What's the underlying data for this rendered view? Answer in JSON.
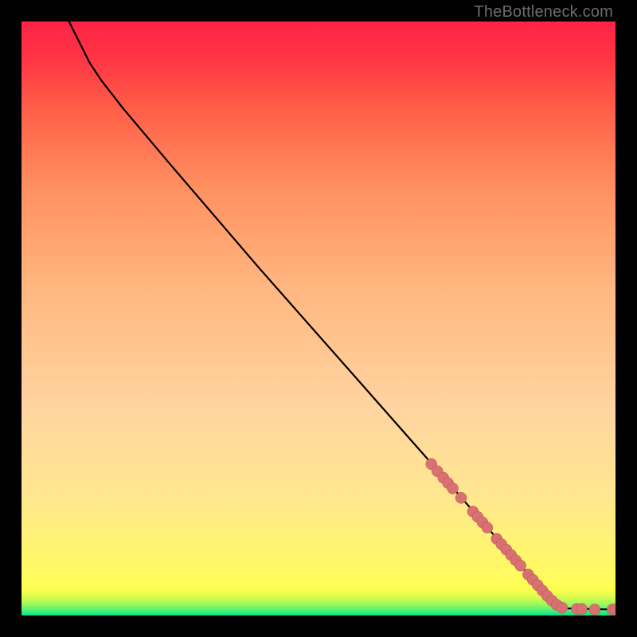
{
  "attribution": "TheBottleneck.com",
  "chart_data": {
    "type": "line",
    "title": "",
    "xlabel": "",
    "ylabel": "",
    "xlim": [
      0,
      100
    ],
    "ylim": [
      0,
      100
    ],
    "curve": [
      {
        "x": 8.0,
        "y": 100.0
      },
      {
        "x": 9.5,
        "y": 97.0
      },
      {
        "x": 11.5,
        "y": 93.0
      },
      {
        "x": 13.5,
        "y": 90.0
      },
      {
        "x": 17.0,
        "y": 85.5
      },
      {
        "x": 25.0,
        "y": 76.0
      },
      {
        "x": 40.0,
        "y": 58.5
      },
      {
        "x": 55.0,
        "y": 41.5
      },
      {
        "x": 70.0,
        "y": 24.5
      },
      {
        "x": 80.0,
        "y": 13.0
      },
      {
        "x": 87.0,
        "y": 5.0
      },
      {
        "x": 90.0,
        "y": 1.8
      },
      {
        "x": 91.5,
        "y": 1.2
      },
      {
        "x": 100.0,
        "y": 1.0
      }
    ],
    "markers": [
      {
        "x": 69.0,
        "y": 25.5
      },
      {
        "x": 70.0,
        "y": 24.3
      },
      {
        "x": 71.0,
        "y": 23.2
      },
      {
        "x": 71.8,
        "y": 22.3
      },
      {
        "x": 72.6,
        "y": 21.4
      },
      {
        "x": 74.0,
        "y": 19.8
      },
      {
        "x": 76.0,
        "y": 17.5
      },
      {
        "x": 76.8,
        "y": 16.6
      },
      {
        "x": 77.6,
        "y": 15.7
      },
      {
        "x": 78.4,
        "y": 14.8
      },
      {
        "x": 80.0,
        "y": 12.9
      },
      {
        "x": 80.8,
        "y": 12.0
      },
      {
        "x": 81.6,
        "y": 11.1
      },
      {
        "x": 82.4,
        "y": 10.2
      },
      {
        "x": 83.2,
        "y": 9.3
      },
      {
        "x": 84.0,
        "y": 8.4
      },
      {
        "x": 85.3,
        "y": 6.9
      },
      {
        "x": 86.1,
        "y": 6.0
      },
      {
        "x": 86.9,
        "y": 5.1
      },
      {
        "x": 87.7,
        "y": 4.2
      },
      {
        "x": 88.5,
        "y": 3.3
      },
      {
        "x": 89.3,
        "y": 2.5
      },
      {
        "x": 90.1,
        "y": 1.8
      },
      {
        "x": 91.0,
        "y": 1.3
      },
      {
        "x": 93.5,
        "y": 1.1
      },
      {
        "x": 94.3,
        "y": 1.1
      },
      {
        "x": 96.5,
        "y": 1.0
      },
      {
        "x": 99.5,
        "y": 1.0
      },
      {
        "x": 100.0,
        "y": 1.0
      }
    ]
  }
}
